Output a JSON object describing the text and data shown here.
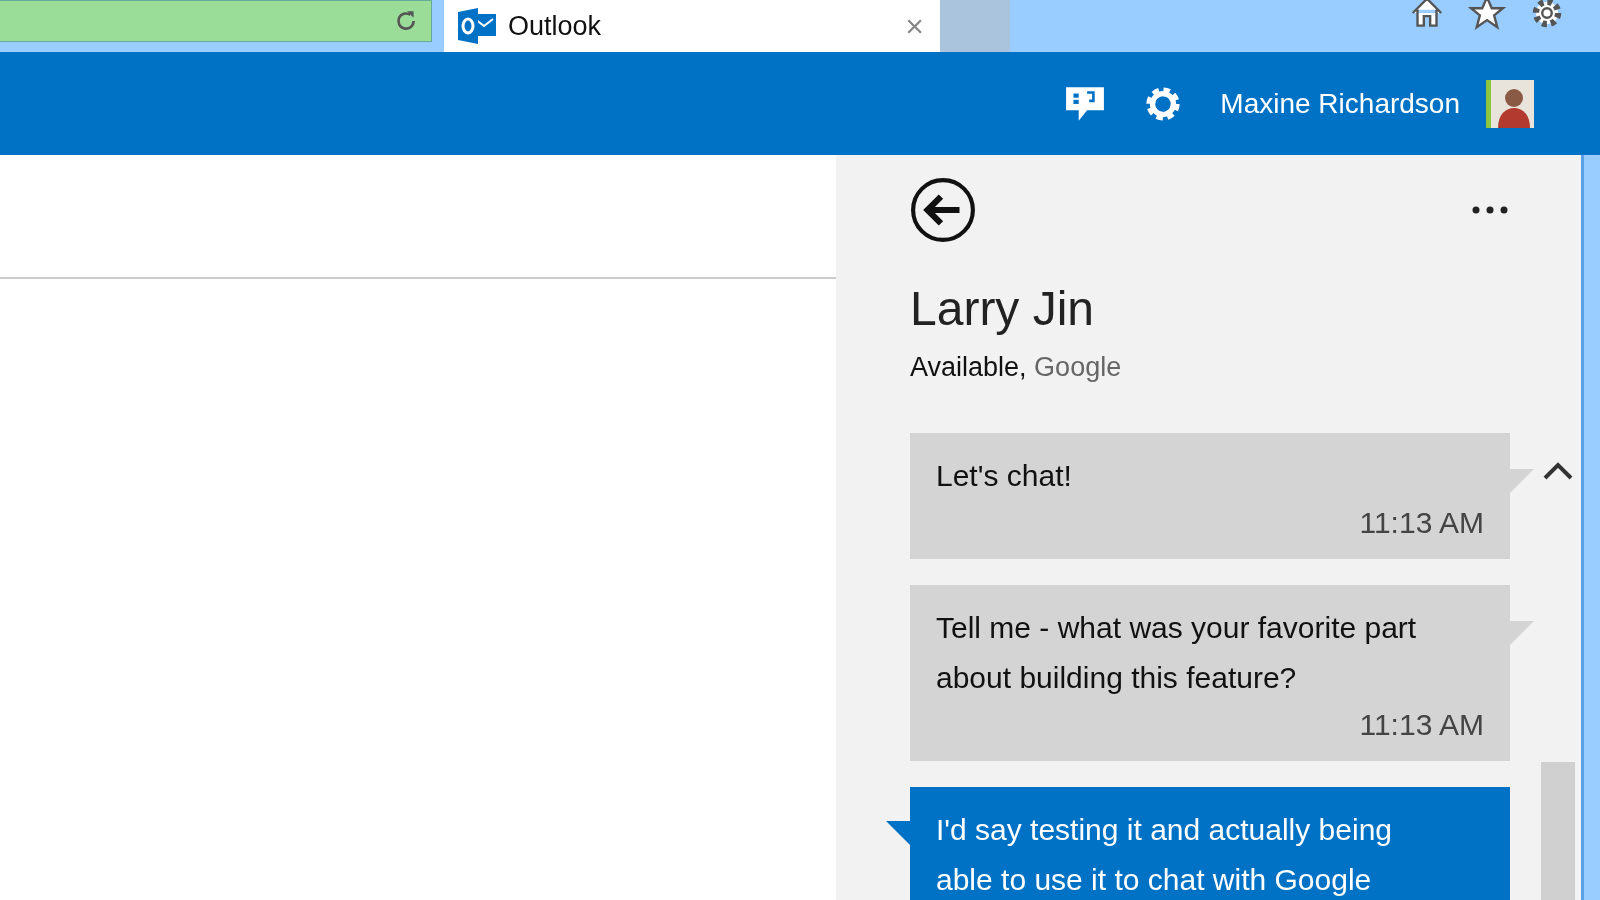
{
  "browser": {
    "tab": {
      "title": "Outlook",
      "close": "×"
    }
  },
  "header": {
    "user_name": "Maxine Richardson"
  },
  "chat": {
    "contact": "Larry Jin",
    "status": "Available,",
    "service": "Google",
    "messages": [
      {
        "kind": "incoming",
        "text": "Let's chat!",
        "time": "11:13 AM"
      },
      {
        "kind": "incoming",
        "text": "Tell me - what was your favorite part about building this feature?",
        "time": "11:13 AM"
      },
      {
        "kind": "outgoing",
        "text": "I'd say testing it and actually being able to use it to chat with Google"
      }
    ]
  }
}
